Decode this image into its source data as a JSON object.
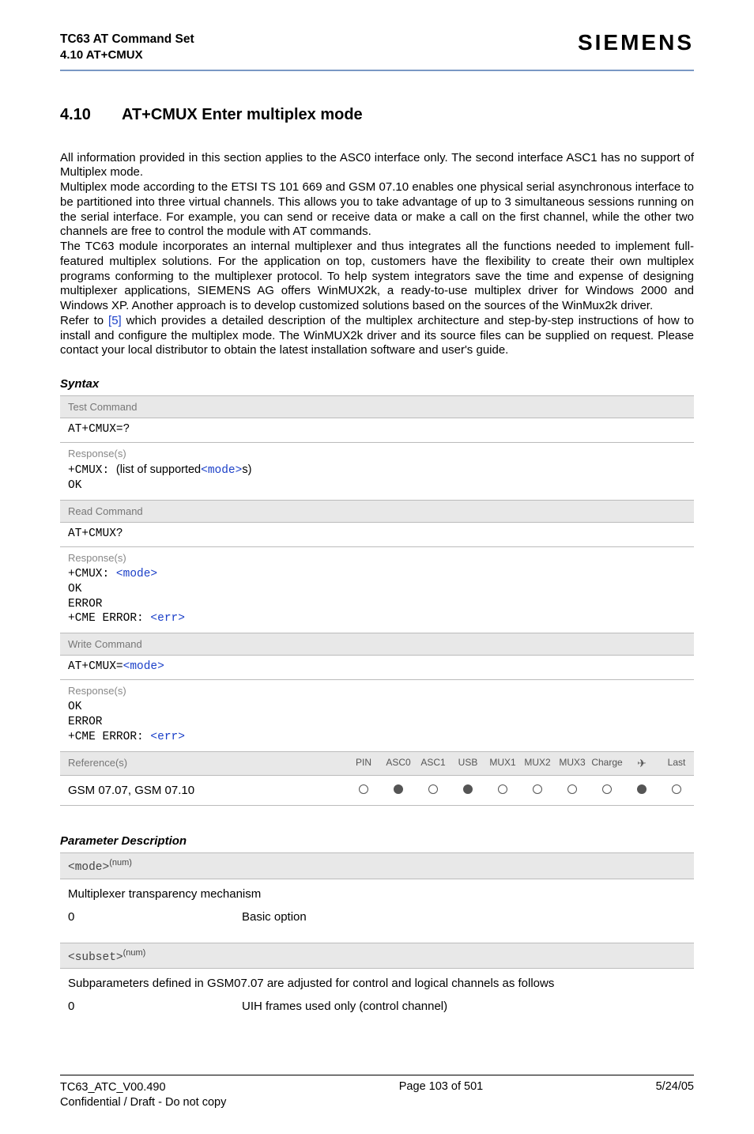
{
  "header": {
    "title": "TC63 AT Command Set",
    "subtitle": "4.10 AT+CMUX",
    "brand": "SIEMENS"
  },
  "section": {
    "number": "4.10",
    "title": "AT+CMUX   Enter multiplex mode"
  },
  "body": {
    "p1": "All information provided in this section applies to the ASC0 interface only. The second interface ASC1 has no support of Multiplex mode.",
    "p2": "Multiplex mode according to the ETSI TS 101 669 and GSM 07.10 enables one physical serial asynchronous interface to be partitioned into three virtual channels. This allows you to take advantage of up to 3 simultaneous sessions running on the serial interface. For example, you can send or receive data or make a call on the first channel, while the other two channels are free to control the module with AT commands.",
    "p3": "The TC63 module incorporates an internal multiplexer and thus integrates all the functions needed to implement full-featured multiplex solutions. For the application on top, customers have the flexibility to create their own multiplex programs conforming to the multiplexer protocol. To help system integrators save the time and expense of designing multiplexer applications, SIEMENS AG offers WinMUX2k, a ready-to-use multiplex driver for Windows 2000 and Windows XP. Another approach is to develop customized solutions based on the sources of the WinMux2k driver.",
    "p4a": "Refer to ",
    "p4ref": "[5]",
    "p4b": " which provides a detailed description of the multiplex architecture and step-by-step instructions of how to install and configure the multiplex mode. The WinMUX2k driver and its source files can be supplied on request. Please contact your local distributor to obtain the latest installation software and user's guide."
  },
  "syntax": {
    "heading": "Syntax",
    "test_label": "Test Command",
    "test_cmd": "AT+CMUX=?",
    "test_resp_label": "Response(s)",
    "test_resp_prefix": "+CMUX: ",
    "test_resp_mid": "(list of supported",
    "test_resp_param": "<mode>",
    "test_resp_suffix": "s)",
    "test_resp_ok": "OK",
    "read_label": "Read Command",
    "read_cmd": "AT+CMUX?",
    "read_resp_label": "Response(s)",
    "read_resp_prefix": "+CMUX: ",
    "read_resp_param": "<mode>",
    "read_resp_ok": "OK",
    "read_resp_error": "ERROR",
    "read_resp_cme_prefix": "+CME ERROR: ",
    "read_resp_cme_param": "<err>",
    "write_label": "Write Command",
    "write_cmd_prefix": "AT+CMUX=",
    "write_cmd_param": "<mode>",
    "write_resp_label": "Response(s)",
    "write_resp_ok": "OK",
    "write_resp_error": "ERROR",
    "write_resp_cme_prefix": "+CME ERROR: ",
    "write_resp_cme_param": "<err>",
    "ref_label": "Reference(s)",
    "ref_value": "GSM 07.07, GSM 07.10",
    "ref_cols": [
      "PIN",
      "ASC0",
      "ASC1",
      "USB",
      "MUX1",
      "MUX2",
      "MUX3",
      "Charge",
      "✈",
      "Last"
    ],
    "ref_states": [
      "open",
      "filled",
      "open",
      "filled",
      "open",
      "open",
      "open",
      "open",
      "filled",
      "open"
    ]
  },
  "params": {
    "heading": "Parameter Description",
    "mode_name": "<mode>",
    "mode_sup": "(num)",
    "mode_desc": "Multiplexer transparency mechanism",
    "mode_val": "0",
    "mode_val_desc": "Basic option",
    "subset_name": "<subset>",
    "subset_sup": "(num)",
    "subset_desc": "Subparameters defined in GSM07.07 are adjusted for control and logical channels as follows",
    "subset_val": "0",
    "subset_val_desc": "UIH frames used only (control channel)"
  },
  "footer": {
    "left1": "TC63_ATC_V00.490",
    "left2": "Confidential / Draft - Do not copy",
    "center": "Page 103 of 501",
    "right": "5/24/05"
  }
}
